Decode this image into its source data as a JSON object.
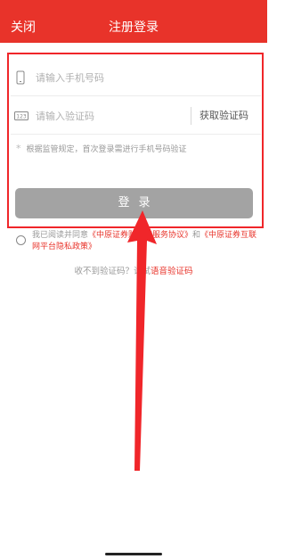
{
  "nav": {
    "close_label": "关闭",
    "title": "注册登录"
  },
  "form": {
    "phone_placeholder": "请输入手机号码",
    "code_placeholder": "请输入验证码",
    "code_icon_text": "123",
    "get_code_label": "获取验证码",
    "hint_star": "*",
    "hint_text": "根据监管规定，首次登录需进行手机号码验证",
    "login_label": "登录"
  },
  "agreement": {
    "prefix": "我已阅读并同意",
    "link1": "《中原证券财升宝服务协议》",
    "and": "和",
    "link2": "《中原证券互联网平台隐私政策》"
  },
  "voice": {
    "prefix": "收不到验证码？",
    "middle": "试试",
    "link": "语音验证码"
  },
  "colors": {
    "brand_red": "#e8332a",
    "button_gray": "#a3a3a3",
    "annotation_red": "#f0262a"
  }
}
